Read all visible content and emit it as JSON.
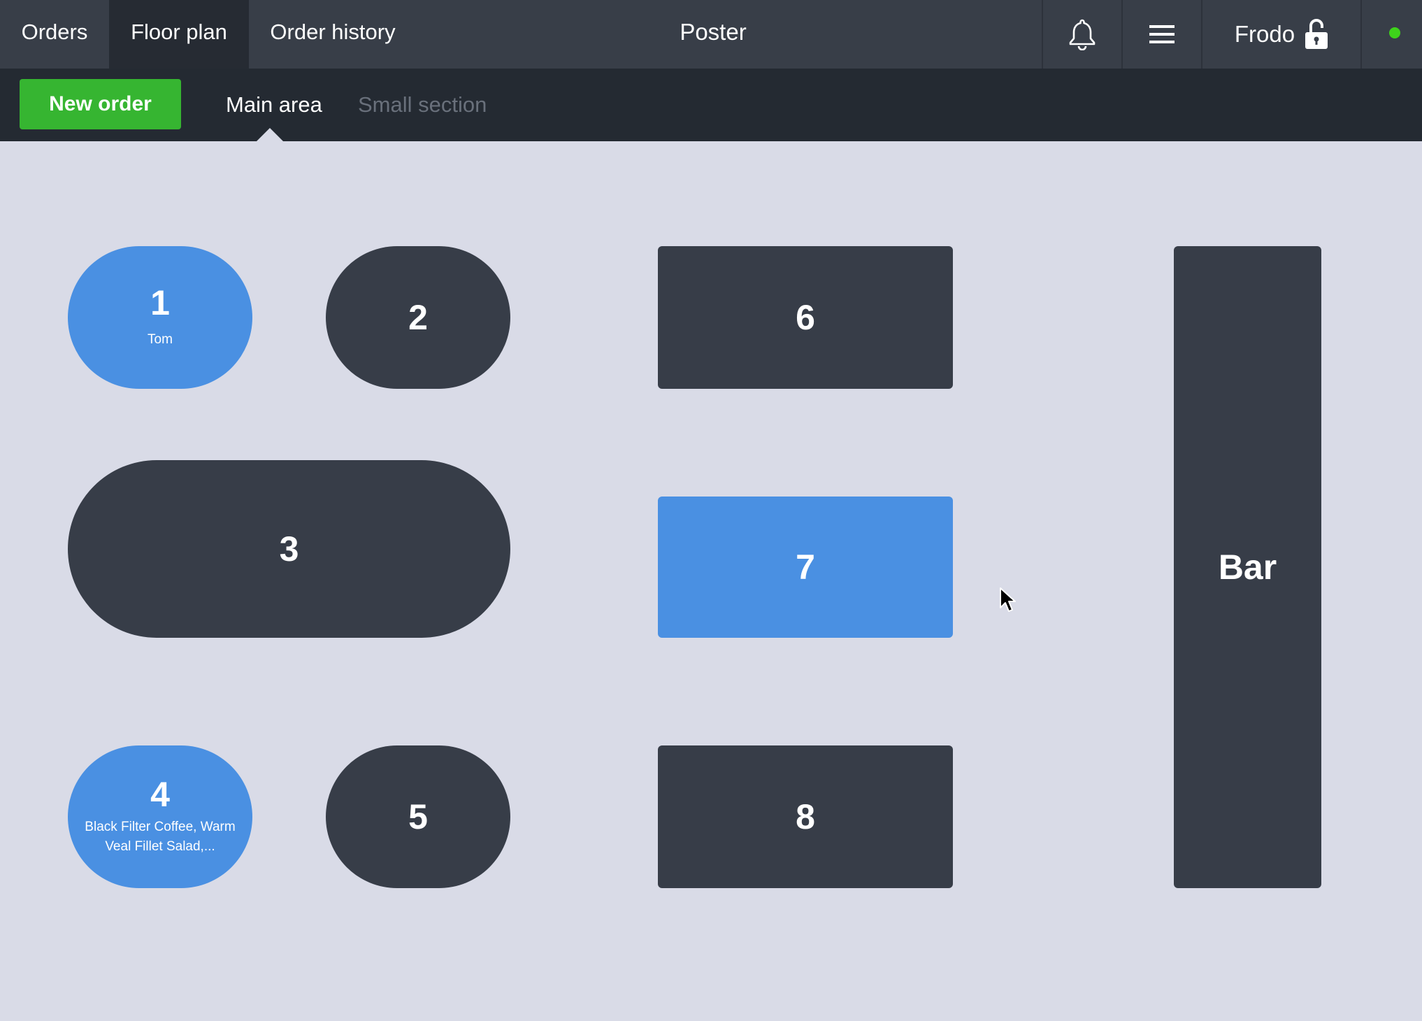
{
  "nav": {
    "tabs": [
      {
        "label": "Orders"
      },
      {
        "label": "Floor plan",
        "active": true
      },
      {
        "label": "Order history"
      }
    ],
    "app_title": "Poster",
    "notifications_icon": "bell-icon",
    "menu_icon": "hamburger-menu-icon",
    "user": {
      "name": "Frodo",
      "lock_icon": "unlocked-padlock-icon"
    },
    "status": {
      "color": "#3ed31b"
    }
  },
  "subnav": {
    "new_order_label": "New order",
    "areas": [
      {
        "label": "Main area",
        "active": true
      },
      {
        "label": "Small section",
        "active": false
      }
    ]
  },
  "colors": {
    "occupied": "#4a90e2",
    "free": "#373d48",
    "new_order": "#36b531",
    "background": "#d9dbe7"
  },
  "floor": {
    "tables": [
      {
        "number": "1",
        "note": "Tom",
        "occupied": true
      },
      {
        "number": "2",
        "note": "",
        "occupied": false
      },
      {
        "number": "3",
        "note": "",
        "occupied": false
      },
      {
        "number": "4",
        "note": "Black Filter Coffee, Warm Veal Fillet Salad,...",
        "occupied": true
      },
      {
        "number": "5",
        "note": "",
        "occupied": false
      },
      {
        "number": "6",
        "note": "",
        "occupied": false
      },
      {
        "number": "7",
        "note": "",
        "occupied": true
      },
      {
        "number": "8",
        "note": "",
        "occupied": false
      },
      {
        "number": "Bar",
        "note": "",
        "occupied": false
      }
    ]
  }
}
